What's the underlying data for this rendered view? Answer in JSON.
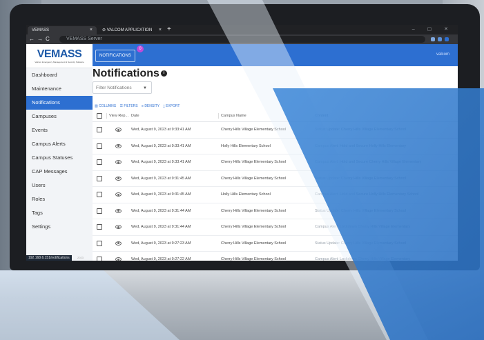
{
  "browser": {
    "tabs": [
      {
        "label": "VEMASS"
      },
      {
        "label": "VALCOM APPLICATION SERVER"
      }
    ],
    "address": "VEMASS Server",
    "status_url": "192.168.6.151/notifications"
  },
  "app": {
    "logo_text": "VEMASS",
    "logo_tagline": "Valcom Emergency Management & Security Software"
  },
  "sidebar": {
    "items": [
      {
        "label": "Dashboard"
      },
      {
        "label": "Maintenance"
      },
      {
        "label": "Notifications"
      },
      {
        "label": "Campuses"
      },
      {
        "label": "Events"
      },
      {
        "label": "Campus Alerts"
      },
      {
        "label": "Campus Statuses"
      },
      {
        "label": "CAP Messages"
      },
      {
        "label": "Users"
      },
      {
        "label": "Roles"
      },
      {
        "label": "Tags"
      },
      {
        "label": "Settings"
      }
    ],
    "footer": "2023"
  },
  "topbar": {
    "notifications_label": "NOTIFICATIONS",
    "notifications_count": "0",
    "user": "valcom"
  },
  "page": {
    "title": "Notifications",
    "filter_placeholder": "Filter Notifications"
  },
  "toolbar": {
    "columns": "COLUMNS",
    "filters": "FILTERS",
    "density": "DENSITY",
    "export": "EXPORT"
  },
  "table": {
    "headers": {
      "view": "View Rep...",
      "date": "Date",
      "campus": "Campus Name",
      "content": "Content"
    },
    "rows": [
      {
        "date": "Wed, August 9, 2023 at 9:33:41 AM",
        "campus": "Cherry Hills Village Elementary School",
        "content": "Status Update: Cherry Hills Village Elementary School"
      },
      {
        "date": "Wed, August 9, 2023 at 9:33:41 AM",
        "campus": "Holly Hills Elementary School",
        "content": "Campus Alert: Hold and Secure Holly Hills Elementary"
      },
      {
        "date": "Wed, August 9, 2023 at 9:33:41 AM",
        "campus": "Cherry Hills Village Elementary School",
        "content": "Campus Alert: Hold and Secure Cherry Hills Village Elementary"
      },
      {
        "date": "Wed, August 9, 2023 at 9:31:45 AM",
        "campus": "Cherry Hills Village Elementary School",
        "content": "Status Update: Cherry Hills Village Elementary School"
      },
      {
        "date": "Wed, August 9, 2023 at 9:31:45 AM",
        "campus": "Holly Hills Elementary School",
        "content": "Campus Alert: Hold and Secure Holly Hills Elementary School"
      },
      {
        "date": "Wed, August 9, 2023 at 9:31:44 AM",
        "campus": "Cherry Hills Village Elementary School",
        "content": "Status Update: Cherry Hills Village Elementary School"
      },
      {
        "date": "Wed, August 9, 2023 at 9:31:44 AM",
        "campus": "Cherry Hills Village Elementary School",
        "content": "Campus Alert: Lockdown Cherry Hills Village Elementary"
      },
      {
        "date": "Wed, August 9, 2023 at 9:27:23 AM",
        "campus": "Cherry Hills Village Elementary School",
        "content": "Status Update: Cherry Hills Village Elementary School"
      },
      {
        "date": "Wed, August 9, 2023 at 9:27:22 AM",
        "campus": "Cherry Hills Village Elementary School",
        "content": "Campus Alert: Lockdown Cherry Hills Village Elementary"
      }
    ]
  },
  "colors": {
    "brand_blue": "#2d6fd1",
    "logo_blue": "#1e5aa8",
    "overlay_blue": "#3a86d8",
    "overlay_light": "#cfe2f5"
  }
}
